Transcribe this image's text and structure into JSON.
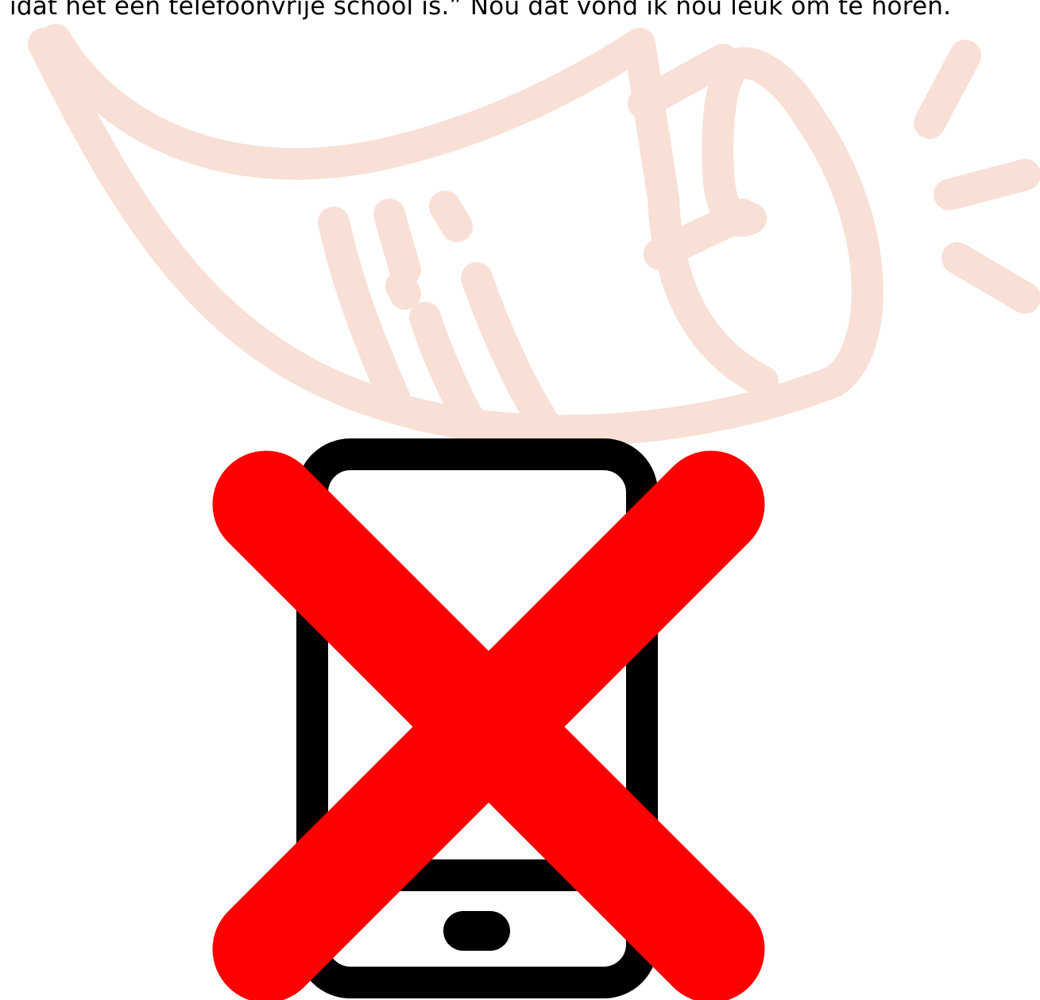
{
  "caption": {
    "text": "idat het een telefoonvrije school is.” Nou dat vond ik nou leuk om te horen."
  },
  "illustration": {
    "horn_icon": "shofar-horn-icon",
    "phone_icon": "smartphone-icon",
    "cross_icon": "red-cross-icon"
  },
  "colors": {
    "horn": "#f8e0d6",
    "phone": "#000000",
    "cross": "#ff0000",
    "background": "#ffffff"
  }
}
